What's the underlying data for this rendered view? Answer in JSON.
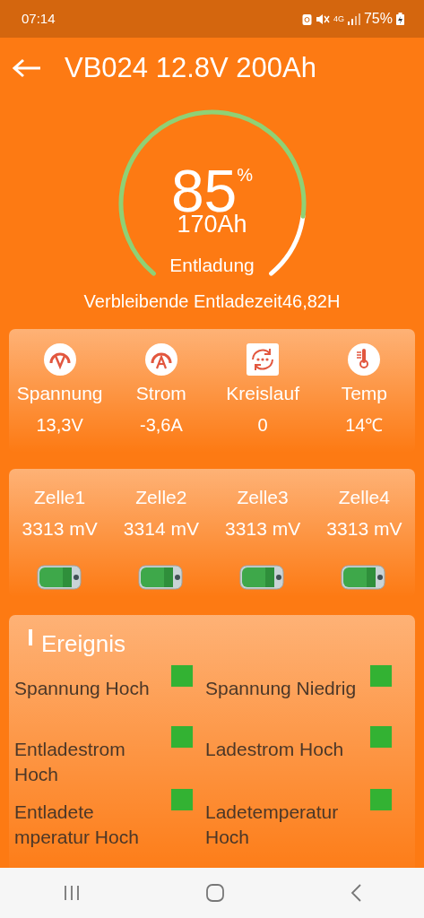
{
  "status_bar": {
    "time": "07:14",
    "network": "4G",
    "battery": "75%"
  },
  "app_bar": {
    "title": "VB024 12.8V 200Ah"
  },
  "gauge": {
    "value": "85",
    "unit": "%",
    "capacity": "170Ah",
    "mode": "Entladung",
    "remaining": "Verbleibende Entladezeit46,82H"
  },
  "metrics": [
    {
      "kind": "voltage",
      "label": "Spannung",
      "value": "13,3V"
    },
    {
      "kind": "current",
      "label": "Strom",
      "value": "-3,6A"
    },
    {
      "kind": "cycle",
      "label": "Kreislauf",
      "value": "0"
    },
    {
      "kind": "temperature",
      "label": "Temp",
      "value": "14℃"
    }
  ],
  "cells": [
    {
      "name": "Zelle1",
      "voltage": "3313 mV"
    },
    {
      "name": "Zelle2",
      "voltage": "3314 mV"
    },
    {
      "name": "Zelle3",
      "voltage": "3313 mV"
    },
    {
      "name": "Zelle4",
      "voltage": "3313 mV"
    }
  ],
  "events": {
    "title": "Ereignis",
    "items": [
      {
        "label": "Spannung Hoch",
        "color": "#33b233"
      },
      {
        "label": "Spannung Niedrig",
        "color": "#33b233"
      },
      {
        "label": "Entladestrom Hoch",
        "color": "#33b233"
      },
      {
        "label": "Ladestrom Hoch",
        "color": "#33b233"
      },
      {
        "label": "Entladete mperatur Hoch",
        "color": "#33b233"
      },
      {
        "label": "Ladetemperatur Hoch",
        "color": "#33b233"
      }
    ]
  }
}
